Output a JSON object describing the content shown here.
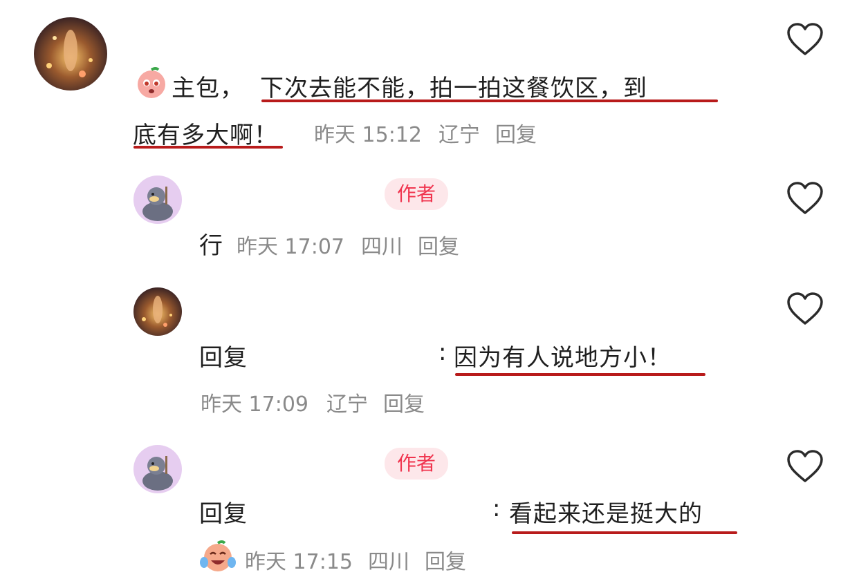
{
  "comments": [
    {
      "prefix_line1": "主包，",
      "highlight_line1": "下次去能不能，拍一拍这餐饮区，到",
      "highlight_line2": "底有多大啊！",
      "time": "昨天 15:12",
      "location": "辽宁",
      "reply_label": "回复",
      "emoji": "pleading-face-emoji"
    },
    {
      "badge": "作者",
      "text": "行",
      "time": "昨天 17:07",
      "location": "四川",
      "reply_label": "回复"
    },
    {
      "reply_prefix": "回复",
      "colon": ":",
      "highlight": "因为有人说地方小！",
      "time": "昨天 17:09",
      "location": "辽宁",
      "reply_label": "回复"
    },
    {
      "badge": "作者",
      "reply_prefix": "回复",
      "colon": ":",
      "highlight": "看起来还是挺大的",
      "time": "昨天 17:15",
      "location": "四川",
      "reply_label": "回复",
      "emoji": "laughing-tears-emoji"
    }
  ],
  "colors": {
    "underline": "#b81b1b",
    "badge_bg": "#fde7ea",
    "badge_text": "#f0354f",
    "meta": "#8a8a8a"
  },
  "icons": [
    "heart-outline-icon"
  ]
}
